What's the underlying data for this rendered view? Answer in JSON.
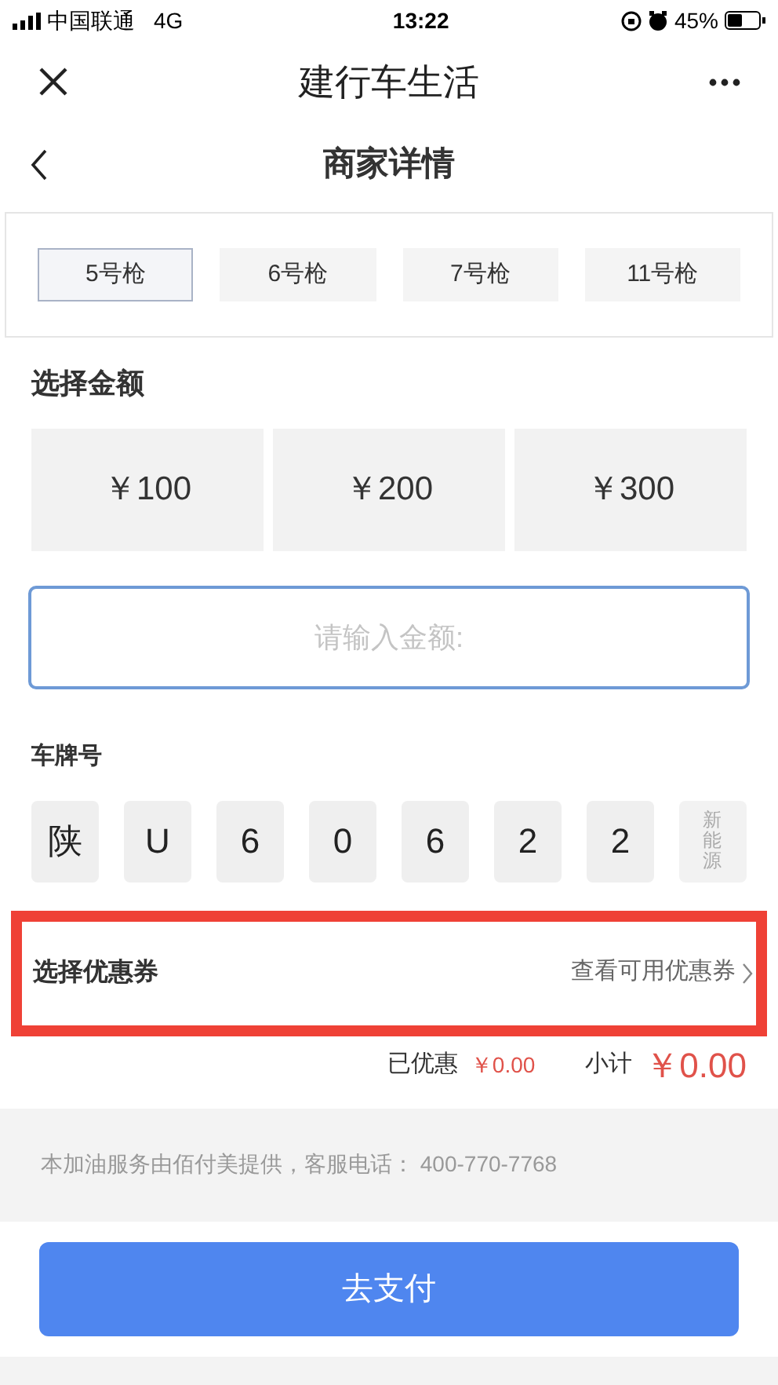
{
  "status_bar": {
    "carrier": "中国联通",
    "network": "4G",
    "time": "13:22",
    "battery": "45%"
  },
  "app_bar": {
    "title": "建行车生活"
  },
  "header": {
    "title": "商家详情"
  },
  "nozzles": [
    {
      "label": "5号枪",
      "selected": true
    },
    {
      "label": "6号枪",
      "selected": false
    },
    {
      "label": "7号枪",
      "selected": false
    },
    {
      "label": "11号枪",
      "selected": false
    }
  ],
  "amount_section": {
    "title": "选择金额",
    "options": [
      {
        "label": "￥100",
        "selected": false
      },
      {
        "label": "￥200",
        "selected": false
      },
      {
        "label": "￥300",
        "selected": false
      }
    ],
    "input": {
      "placeholder": "请输入金额:"
    }
  },
  "plate": {
    "title": "车牌号",
    "cells": [
      {
        "kind": "char",
        "text": "陕"
      },
      {
        "kind": "char",
        "text": "U"
      },
      {
        "kind": "char",
        "text": "6"
      },
      {
        "kind": "char",
        "text": "0"
      },
      {
        "kind": "char",
        "text": "6"
      },
      {
        "kind": "char",
        "text": "2"
      },
      {
        "kind": "char",
        "text": "2"
      },
      {
        "kind": "new_energy",
        "text": "新能源"
      }
    ]
  },
  "coupon": {
    "label": "选择优惠券",
    "link": "查看可用优惠券",
    "highlighted": true
  },
  "totals": {
    "discount_label": "已优惠",
    "discount": "￥0.00",
    "subtotal_label": "小计",
    "subtotal": "￥0.00"
  },
  "notice": "本加油服务由佰付美提供，客服电话： 400-770-7768",
  "pay_button": "去支付"
}
